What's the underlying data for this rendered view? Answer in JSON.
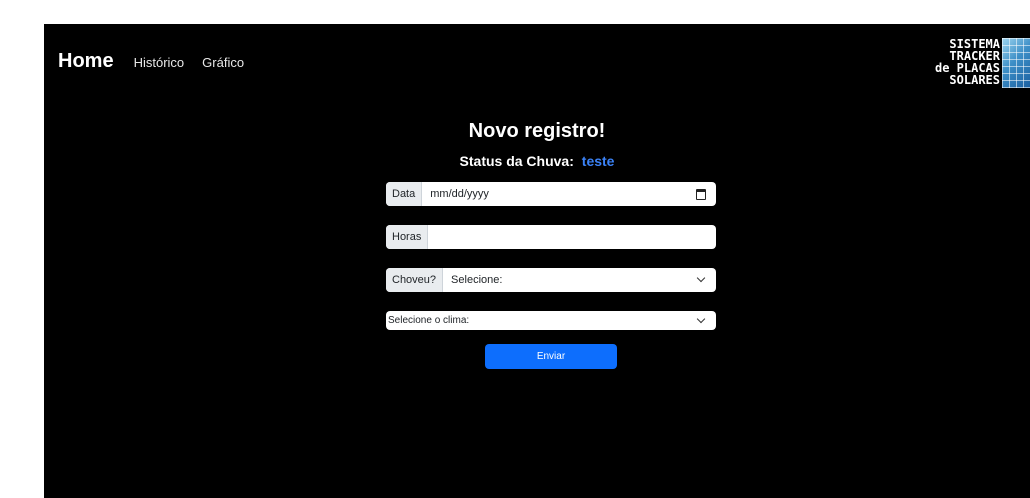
{
  "nav": {
    "brand": "Home",
    "links": [
      "Histórico",
      "Gráfico"
    ]
  },
  "logo": {
    "lines": [
      "SISTEMA",
      "TRACKER",
      "de PLACAS",
      "SOLARES"
    ]
  },
  "form": {
    "title": "Novo registro!",
    "status_label": "Status da Chuva:",
    "status_value": "teste",
    "data_label": "Data",
    "data_placeholder": "mm/dd/yyyy",
    "horas_label": "Horas",
    "horas_value": "",
    "choveu_label": "Choveu?",
    "choveu_selected": "Selecione:",
    "clima_selected": "Selecione o clima:",
    "submit_label": "Enviar"
  },
  "colors": {
    "background": "#000000",
    "accent": "#0d6efd",
    "status_value": "#3b82f6"
  },
  "icons": {
    "date": "calendar-icon",
    "select": "chevron-down-icon"
  }
}
